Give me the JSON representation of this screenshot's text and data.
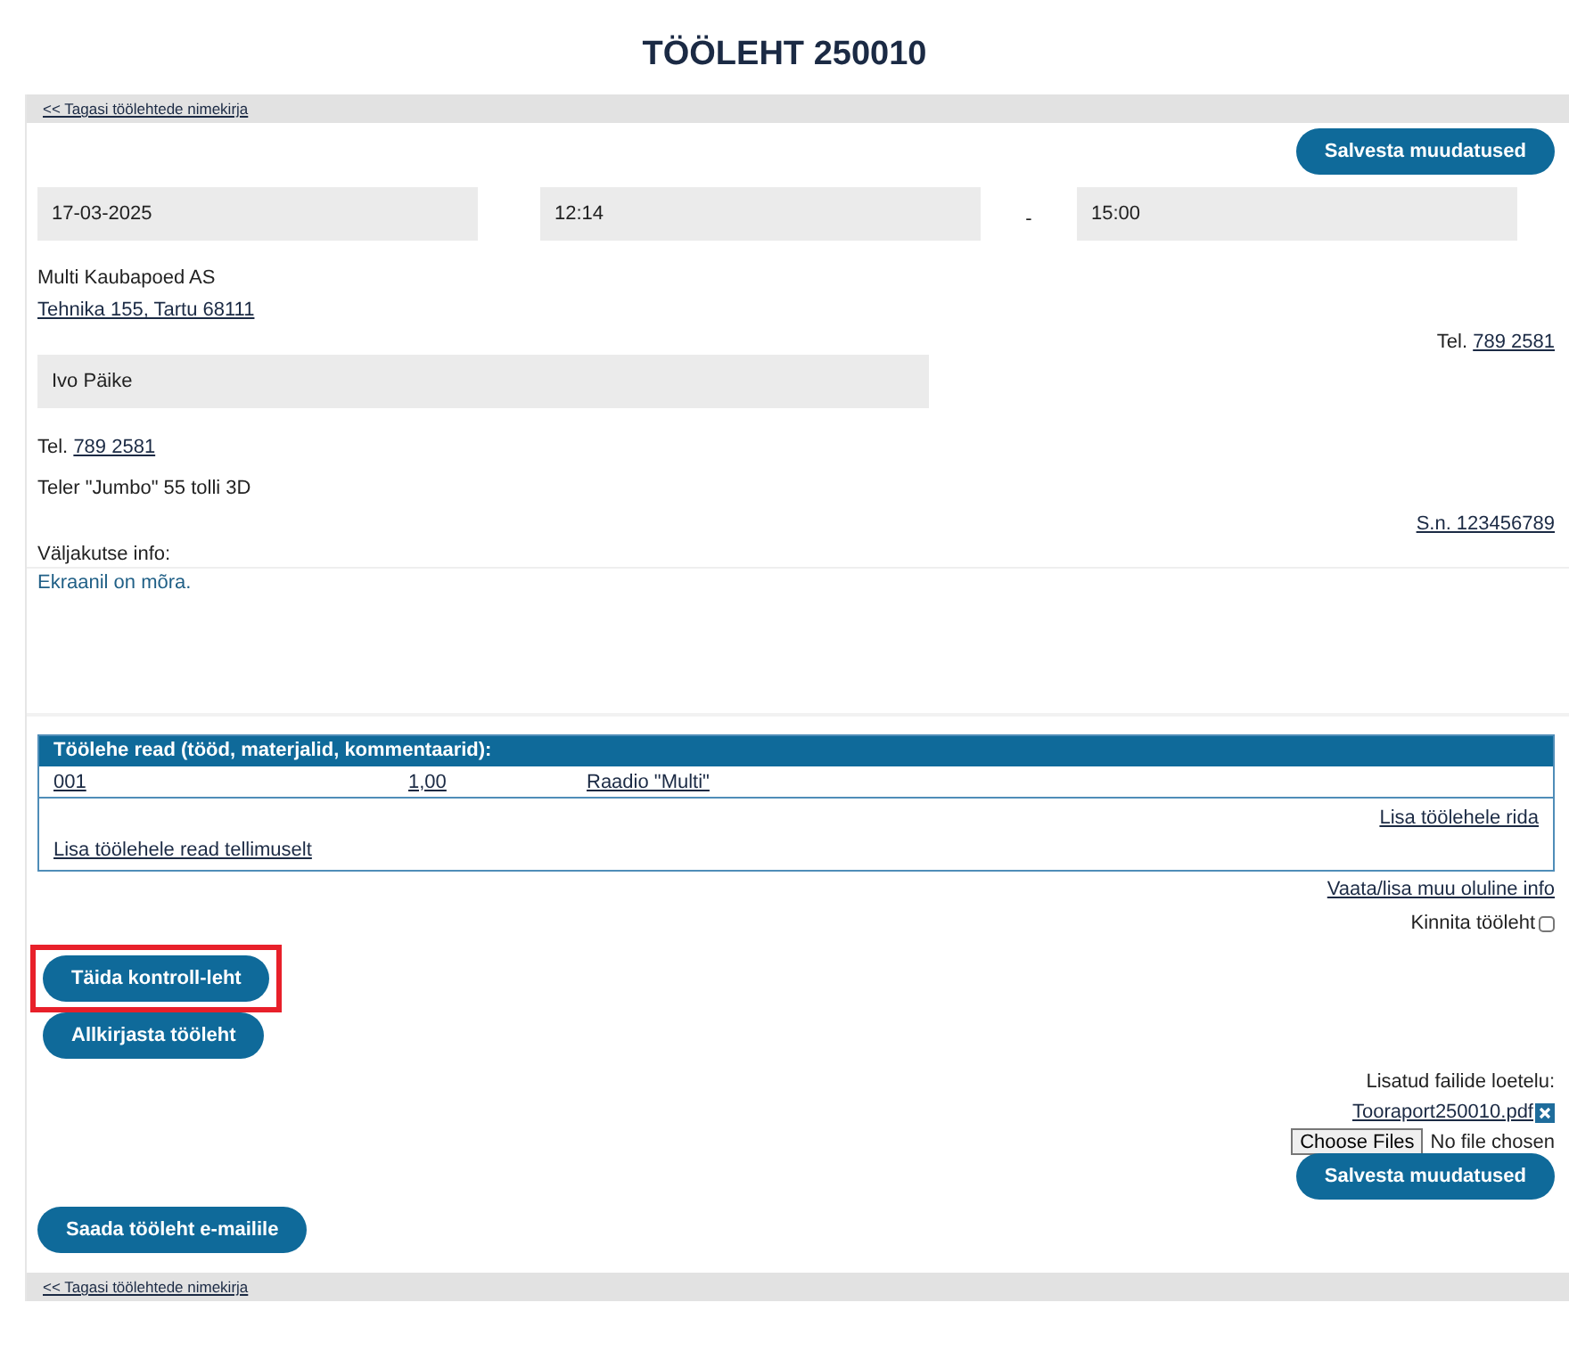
{
  "title": "TÖÖLEHT 250010",
  "back_link_top": "<< Tagasi töölehtede nimekirja",
  "save_button_top": "Salvesta muudatused",
  "date_field": {
    "value": "17-03-2025"
  },
  "start_time_field": {
    "value": "12:14"
  },
  "time_separator": "-",
  "end_time_field": {
    "value": "15:00"
  },
  "customer": {
    "name": "Multi Kaubapoed AS",
    "address": "Tehnika 155, Tartu 68111",
    "phone_label": "Tel.",
    "phone": "789 2581"
  },
  "contact_field": {
    "value": "Ivo Päike"
  },
  "contact_phone_label": "Tel.",
  "contact_phone": "789 2581",
  "device": "Teler \"Jumbo\" 55 tolli 3D",
  "serial": "S.n. 123456789",
  "call_info_label": "Väljakutse info:",
  "call_info": "Ekraanil on mõra.",
  "lines_table": {
    "title": "Töölehe read (tööd, materjalid, kommentaarid):",
    "rows": [
      {
        "code": "001",
        "quantity": "1,00",
        "description": "Raadio \"Multi\""
      }
    ],
    "add_line_link": "Lisa töölehele rida",
    "add_from_order_link": "Lisa töölehele read tellimuselt"
  },
  "more_info_link": "Vaata/lisa muu oluline info",
  "confirm": {
    "label": "Kinnita tööleht",
    "checked": false
  },
  "action_buttons": [
    {
      "label": "Täida kontroll-leht",
      "highlighted": true
    },
    {
      "label": "Allkirjasta tööleht",
      "highlighted": false
    }
  ],
  "files": {
    "label": "Lisatud failide loetelu:",
    "items": [
      {
        "name": "Tooraport250010.pdf"
      }
    ],
    "choose_button": "Choose Files",
    "status": "No file chosen"
  },
  "save_button_bottom": "Salvesta muudatused",
  "email_button": "Saada tööleht e-mailile",
  "back_link_bottom": "<< Tagasi töölehtede nimekirja"
}
